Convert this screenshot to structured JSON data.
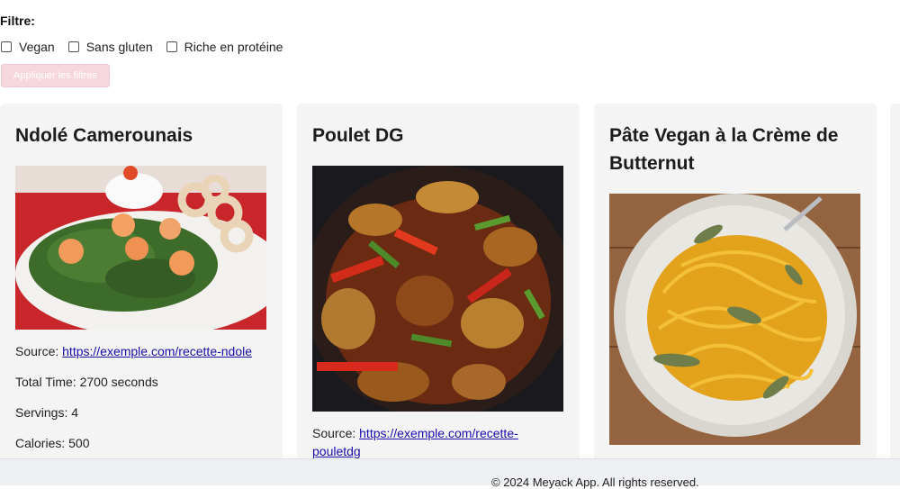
{
  "filters": {
    "title": "Filtre:",
    "options": [
      {
        "label": "Vegan",
        "checked": false
      },
      {
        "label": "Sans gluten",
        "checked": false
      },
      {
        "label": "Riche en protéine",
        "checked": false
      }
    ],
    "apply_label": "Appliquer les filtres"
  },
  "recipes": [
    {
      "title": "Ndolé Camerounais",
      "source_label": "Source:",
      "source_url": "https://exemple.com/recette-ndole",
      "total_time": "Total Time: 2700 seconds",
      "servings": "Servings: 4",
      "calories": "Calories: 500"
    },
    {
      "title": "Poulet DG",
      "source_label": "Source:",
      "source_url_line1": "https://exemple.com/recette-",
      "source_url_line2": "pouletdg"
    },
    {
      "title_line1": "Pâte Vegan à la Crème de",
      "title_line2": "Butternut"
    }
  ],
  "footer": {
    "text": "© 2024 Meyack App. All rights reserved."
  }
}
